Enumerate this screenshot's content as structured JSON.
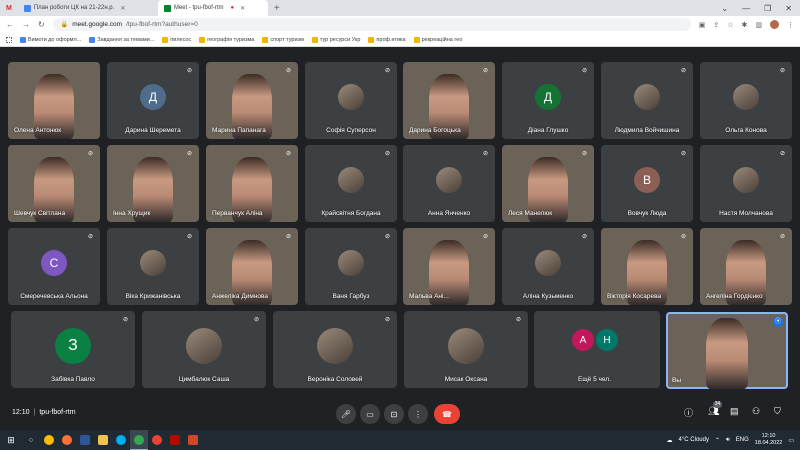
{
  "browser": {
    "tabs": [
      {
        "label": "План роботи ЦК на 21-22н.р.",
        "favicon_color": "#4285f4"
      },
      {
        "label": "Meet - tpu-fbof-rtm",
        "favicon_color": "#00832d"
      }
    ],
    "gmail_label": "M",
    "new_tab": "+",
    "url_host": "meet.google.com",
    "url_path": "/tpu-fbof-rtm?authuser=0",
    "bookmarks": [
      "Вимоги до оформл...",
      "Завдання за темами...",
      "пилесос",
      "географія туризма",
      "спорт туризм",
      "тур ресурси Укр",
      "проф.етика",
      "рекреаційна гео"
    ]
  },
  "participants": [
    {
      "name": "Олена Антонюк",
      "kind": "video",
      "muted": false
    },
    {
      "name": "Дарина Шереметa",
      "kind": "letter",
      "letter": "Д",
      "color": "#4f6d8a",
      "muted": true
    },
    {
      "name": "Марина Папанага",
      "kind": "video",
      "muted": true
    },
    {
      "name": "Софія Суперсон",
      "kind": "photo",
      "muted": true
    },
    {
      "name": "Дарина Богоцька",
      "kind": "video",
      "muted": true
    },
    {
      "name": "Діана Глушко",
      "kind": "letter",
      "letter": "Д",
      "color": "#137333",
      "muted": true
    },
    {
      "name": "Людмила Войчишина",
      "kind": "photo",
      "muted": true
    },
    {
      "name": "Ольга Конова",
      "kind": "photo",
      "muted": true
    },
    {
      "name": "Шевчук Світлана",
      "kind": "video",
      "muted": true
    },
    {
      "name": "Інна Хрущик",
      "kind": "video",
      "muted": true
    },
    {
      "name": "Перванчук Аліна",
      "kind": "video",
      "muted": true
    },
    {
      "name": "Крайсвітня Богдана",
      "kind": "photo",
      "muted": true
    },
    {
      "name": "Анна Янченко",
      "kind": "photo",
      "muted": true
    },
    {
      "name": "Леся Манелюк",
      "kind": "video",
      "muted": true
    },
    {
      "name": "Вовчук Люда",
      "kind": "letter",
      "letter": "В",
      "color": "#8c5f55",
      "muted": true
    },
    {
      "name": "Настя Молчанова",
      "kind": "photo",
      "muted": true
    },
    {
      "name": "Смеречевська Альона",
      "kind": "letter",
      "letter": "С",
      "color": "#7e57c2",
      "muted": true
    },
    {
      "name": "Віка Крижанівська",
      "kind": "photo",
      "muted": true
    },
    {
      "name": "Анжеліка Димнова",
      "kind": "video",
      "muted": true
    },
    {
      "name": "Ваня Гарбуз",
      "kind": "photo",
      "muted": true
    },
    {
      "name": "Мальва Ані...",
      "kind": "video",
      "muted": true
    },
    {
      "name": "Аліна Кузьменко",
      "kind": "photo",
      "muted": true
    },
    {
      "name": "Вікторія Косарева",
      "kind": "video",
      "muted": true
    },
    {
      "name": "Ангеліна Гордієнко",
      "kind": "video",
      "muted": true
    },
    {
      "name": "Забівка Павло",
      "kind": "letter",
      "letter": "З",
      "color": "#0b8043",
      "muted": true
    },
    {
      "name": "Цимбалюк Саша",
      "kind": "photo",
      "muted": true
    },
    {
      "name": "Вероніка Соловей",
      "kind": "photo",
      "muted": true
    },
    {
      "name": "Мисак Оксана",
      "kind": "photo",
      "muted": true
    }
  ],
  "others": {
    "label": "Ещё 5 чел.",
    "avatars": [
      {
        "letter": "А",
        "color": "#c2185b"
      },
      {
        "letter": "Н",
        "color": "#00796b"
      }
    ]
  },
  "self_tile": {
    "label": "Вы"
  },
  "bottom_bar": {
    "time": "12:10",
    "separator": "|",
    "meeting_code": "tpu-fbof-rtm",
    "participants_count": "34"
  },
  "taskbar": {
    "weather": "4°C  Cloudy",
    "lang": "ENG",
    "time": "12:10",
    "date": "18.04.2022"
  },
  "colors": {
    "meet_bg": "#202124",
    "tile_bg": "#3c4043",
    "end_call": "#ea4335",
    "accent": "#1a73e8"
  }
}
